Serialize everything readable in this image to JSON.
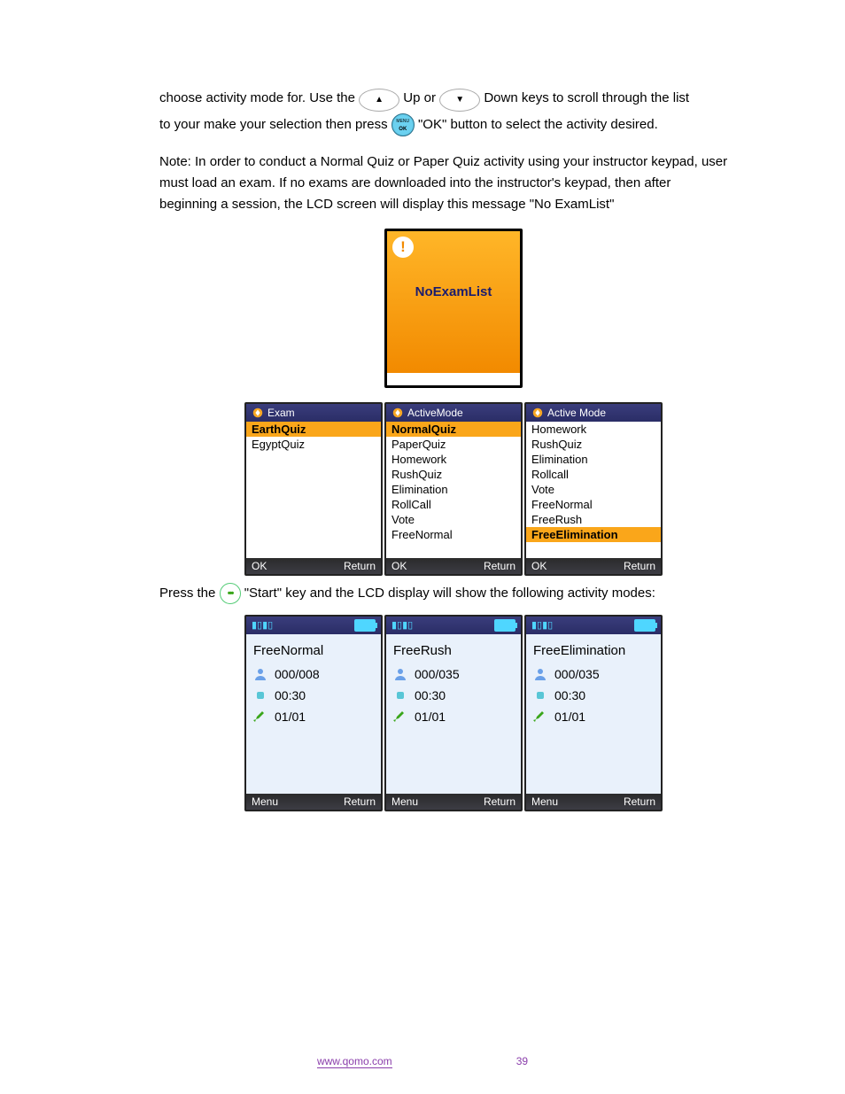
{
  "intro": {
    "p1_a": "choose activity mode for. Use the ",
    "p1_b": " Up or ",
    "p1_c": " Down keys to scroll through the list",
    "p2_a": "to your make your selection then press ",
    "p2_b": " \"",
    "ok_label": "OK",
    "p2_c": "\" button to select the activity desired.",
    "p3": "Note: In order to conduct a Normal Quiz or Paper Quiz activity using your instructor keypad, user",
    "p4_a": "must load an exam. If no exams are downloaded into the instructor's keypad, then after",
    "p4_b": "beginning a session, the LCD screen will display this message \"",
    "noexam_label": "No ExamList",
    "p4_c": "\""
  },
  "noexam_screen": {
    "text": "NoExamList"
  },
  "screen1": {
    "title": "Exam",
    "items": [
      {
        "label": "EarthQuiz",
        "sel": true
      },
      {
        "label": "EgyptQuiz",
        "sel": false
      }
    ],
    "footer_left": "OK",
    "footer_right": "Return"
  },
  "screen2": {
    "title": "ActiveMode",
    "items": [
      {
        "label": "NormalQuiz",
        "sel": true
      },
      {
        "label": "PaperQuiz",
        "sel": false
      },
      {
        "label": "Homework",
        "sel": false
      },
      {
        "label": "RushQuiz",
        "sel": false
      },
      {
        "label": "Elimination",
        "sel": false
      },
      {
        "label": "RollCall",
        "sel": false
      },
      {
        "label": "Vote",
        "sel": false
      },
      {
        "label": "FreeNormal",
        "sel": false
      }
    ],
    "footer_left": "OK",
    "footer_right": "Return"
  },
  "screen3": {
    "title": "Active Mode",
    "items": [
      {
        "label": "Homework",
        "sel": false
      },
      {
        "label": "RushQuiz",
        "sel": false
      },
      {
        "label": "Elimination",
        "sel": false
      },
      {
        "label": "Rollcall",
        "sel": false
      },
      {
        "label": "Vote",
        "sel": false
      },
      {
        "label": "FreeNormal",
        "sel": false
      },
      {
        "label": "FreeRush",
        "sel": false
      },
      {
        "label": "FreeElimination",
        "sel": true
      }
    ],
    "footer_left": "OK",
    "footer_right": "Return"
  },
  "after_screens": {
    "p1_a": "Press the ",
    "p1_b": " \"Start\" key and the LCD display will show the following activity modes:"
  },
  "free1": {
    "title": "FreeNormal",
    "count": "000/008",
    "time": "00:30",
    "prog": "01/01",
    "footer_left": "Menu",
    "footer_right": "Return"
  },
  "free2": {
    "title": "FreeRush",
    "count": "000/035",
    "time": "00:30",
    "prog": "01/01",
    "footer_left": "Menu",
    "footer_right": "Return"
  },
  "free3": {
    "title": "FreeElimination",
    "count": "000/035",
    "time": "00:30",
    "prog": "01/01",
    "footer_left": "Menu",
    "footer_right": "Return"
  },
  "footer": {
    "text": "www.qomo.com",
    "page": "39"
  }
}
